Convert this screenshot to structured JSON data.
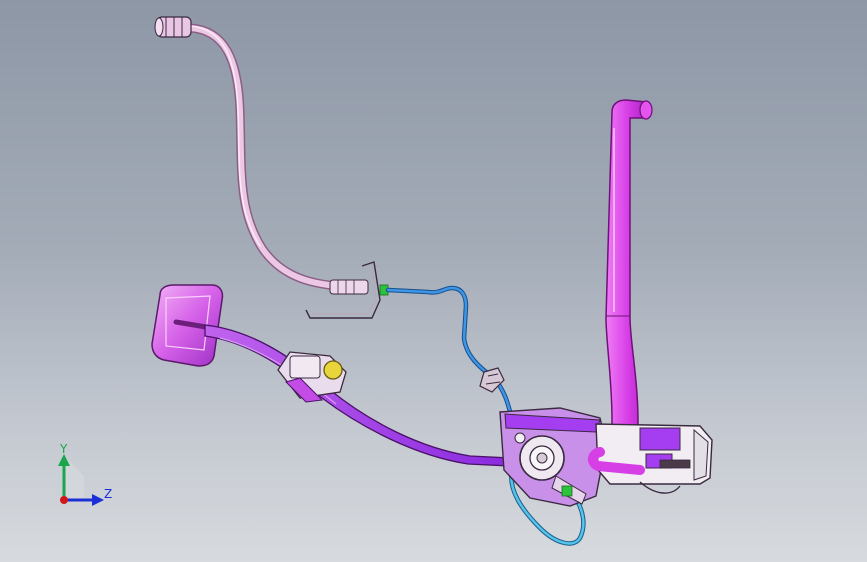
{
  "triad": {
    "y_label": "Y",
    "z_label": "Z",
    "y_color": "#1aa64a",
    "z_color": "#1c2fd6",
    "x_color": "#d01818"
  },
  "colors": {
    "hose_pink": "#e2b6d8",
    "tube_blue": "#2f7fd3",
    "tube_cyan": "#3fb0e0",
    "pipe_magenta": "#d63ee6",
    "housing_purple": "#a83ef0",
    "linework": "#3a2a40"
  }
}
